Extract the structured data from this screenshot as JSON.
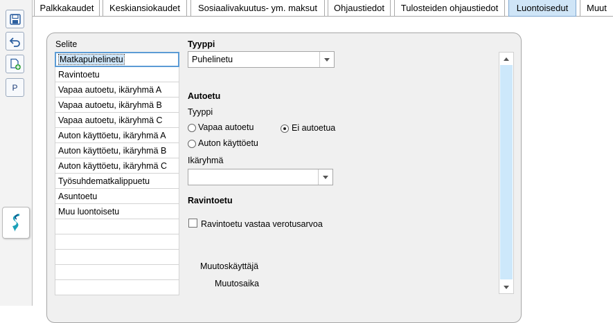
{
  "toolbar": {
    "save_icon": "save-icon",
    "undo_icon": "undo-icon",
    "new_document_icon": "new-document-icon",
    "p_label": "P",
    "logo_icon": "app-logo-icon"
  },
  "tabs": [
    {
      "label": "Palkkakaudet"
    },
    {
      "label": "Keskiansiokaudet"
    },
    {
      "label": "Sosiaalivakuutus- ym. maksut"
    },
    {
      "label": "Ohjaustiedot"
    },
    {
      "label": "Tulosteiden ohjaustiedot"
    },
    {
      "label": "Luontoisedut",
      "active": true
    },
    {
      "label": "Muut"
    }
  ],
  "selite": {
    "header": "Selite",
    "items": [
      "Matkapuhelinetu",
      "Ravintoetu",
      "Vapaa autoetu, ikäryhmä A",
      "Vapaa autoetu, ikäryhmä B",
      "Vapaa autoetu, ikäryhmä C",
      "Auton käyttöetu, ikäryhmä A",
      "Auton käyttöetu, ikäryhmä B",
      "Auton käyttöetu, ikäryhmä C",
      "Työsuhdematkalippuetu",
      "Asuntoetu",
      "Muu luontoisetu"
    ],
    "empty_rows": 5,
    "selected_index": 0
  },
  "form": {
    "tyyppi_label": "Tyyppi",
    "tyyppi_value": "Puhelinetu",
    "autoetu_heading": "Autoetu",
    "autoetu_tyyppi_label": "Tyyppi",
    "radio_vapaa": "Vapaa autoetu",
    "radio_ei": "Ei autoetua",
    "radio_kaytto": "Auton käyttöetu",
    "selected_radio": "Ei autoetua",
    "ikaryhma_label": "Ikäryhmä",
    "ikaryhma_value": "",
    "ravintoetu_heading": "Ravintoetu",
    "ravintoetu_checkbox": "Ravintoetu vastaa verotusarvoa",
    "ravintoetu_checked": false,
    "muutoskayttaja_label": "Muutoskäyttäjä",
    "muutosaika_label": "Muutosaika"
  },
  "colors": {
    "active_tab": "#cfe5f7",
    "selection_border": "#5b9bd5",
    "scroll_thumb": "#cde8fb"
  }
}
